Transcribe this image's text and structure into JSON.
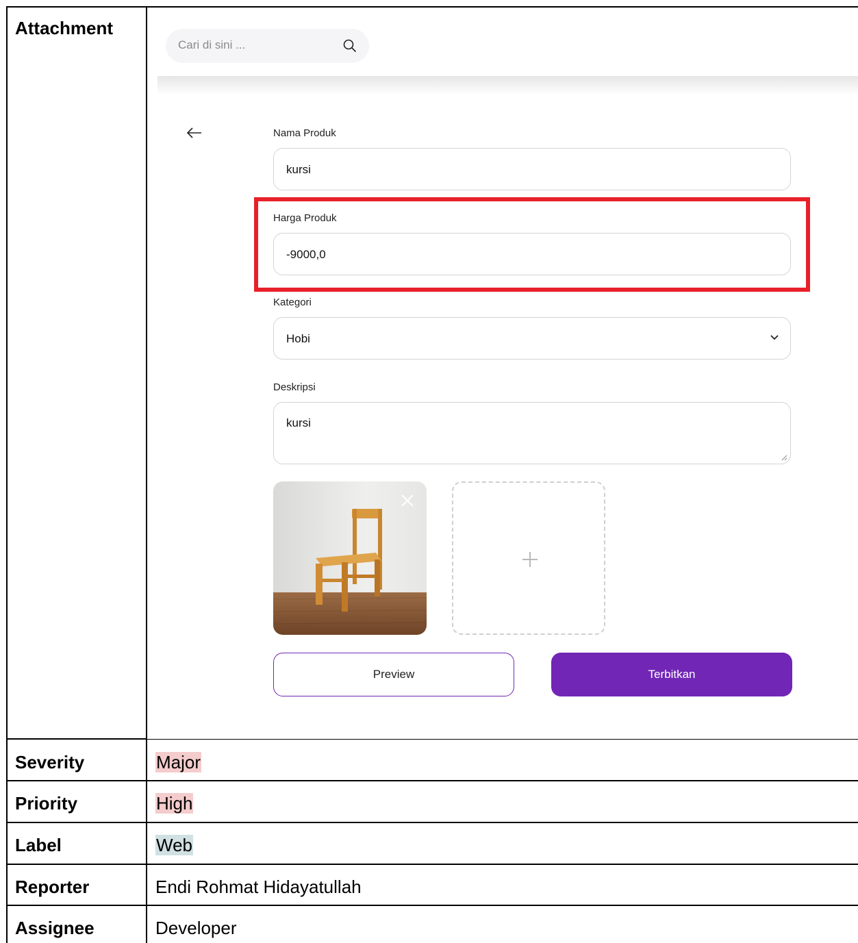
{
  "rows": {
    "attachment_label": "Attachment",
    "severity_label": "Severity",
    "severity_value": "Major",
    "priority_label": "Priority",
    "priority_value": "High",
    "label_label": "Label",
    "label_value": "Web",
    "reporter_label": "Reporter",
    "reporter_value": "Endi Rohmat Hidayatullah",
    "assignee_label": "Assignee",
    "assignee_value": "Developer"
  },
  "screenshot": {
    "search_placeholder": "Cari di sini ...",
    "fields": {
      "nama_label": "Nama Produk",
      "nama_value": "kursi",
      "harga_label": "Harga Produk",
      "harga_value": "-9000,0",
      "kategori_label": "Kategori",
      "kategori_value": "Hobi",
      "deskripsi_label": "Deskripsi",
      "deskripsi_value": "kursi"
    },
    "buttons": {
      "preview": "Preview",
      "publish": "Terbitkan"
    },
    "icons": [
      "search-icon",
      "arrow-left-icon",
      "chevron-down-icon",
      "close-icon",
      "plus-icon"
    ],
    "colors": {
      "primary": "#7126b5",
      "highlight_box": "#e8202a",
      "severity_highlight": "#f4cccc",
      "label_highlight": "#d0e0e3"
    }
  }
}
